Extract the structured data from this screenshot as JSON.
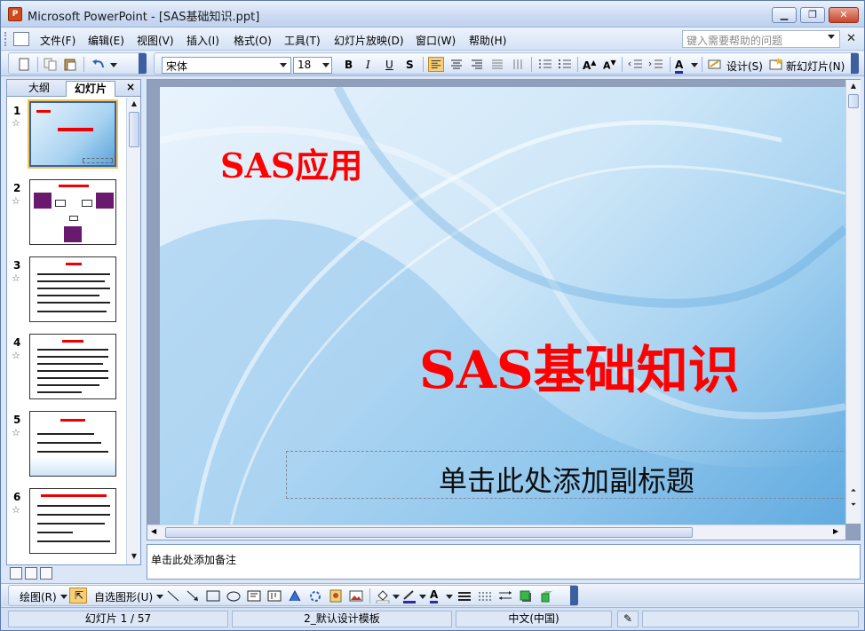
{
  "window": {
    "title": "Microsoft PowerPoint - [SAS基础知识.ppt]"
  },
  "menu": {
    "items": [
      "文件(F)",
      "编辑(E)",
      "视图(V)",
      "插入(I)",
      "格式(O)",
      "工具(T)",
      "幻灯片放映(D)",
      "窗口(W)",
      "帮助(H)"
    ],
    "help_placeholder": "键入需要帮助的问题"
  },
  "toolbar": {
    "font_name": "宋体",
    "font_size": "18",
    "bold_label": "B",
    "italic_label": "I",
    "underline_label": "U",
    "shadow_label": "S",
    "design_label": "设计(S)",
    "new_slide_label": "新幻灯片(N)"
  },
  "left_pane": {
    "tab_outline": "大纲",
    "tab_slides": "幻灯片",
    "close_glyph": "×",
    "thumbnails": [
      {
        "num": "1",
        "title": ""
      },
      {
        "num": "2",
        "title": ""
      },
      {
        "num": "3",
        "title": ""
      },
      {
        "num": "4",
        "title": ""
      },
      {
        "num": "5",
        "title": ""
      },
      {
        "num": "6",
        "title": ""
      }
    ]
  },
  "slide": {
    "header": "SAS应用",
    "title": "SAS基础知识",
    "subtitle_placeholder": "单击此处添加副标题"
  },
  "notes": {
    "placeholder": "单击此处添加备注"
  },
  "drawing": {
    "draw_label": "绘图(R)",
    "autoshapes_label": "自选图形(U)"
  },
  "status": {
    "slide_position": "幻灯片 1 / 57",
    "template": "2_默认设计模板",
    "language": "中文(中国)"
  }
}
